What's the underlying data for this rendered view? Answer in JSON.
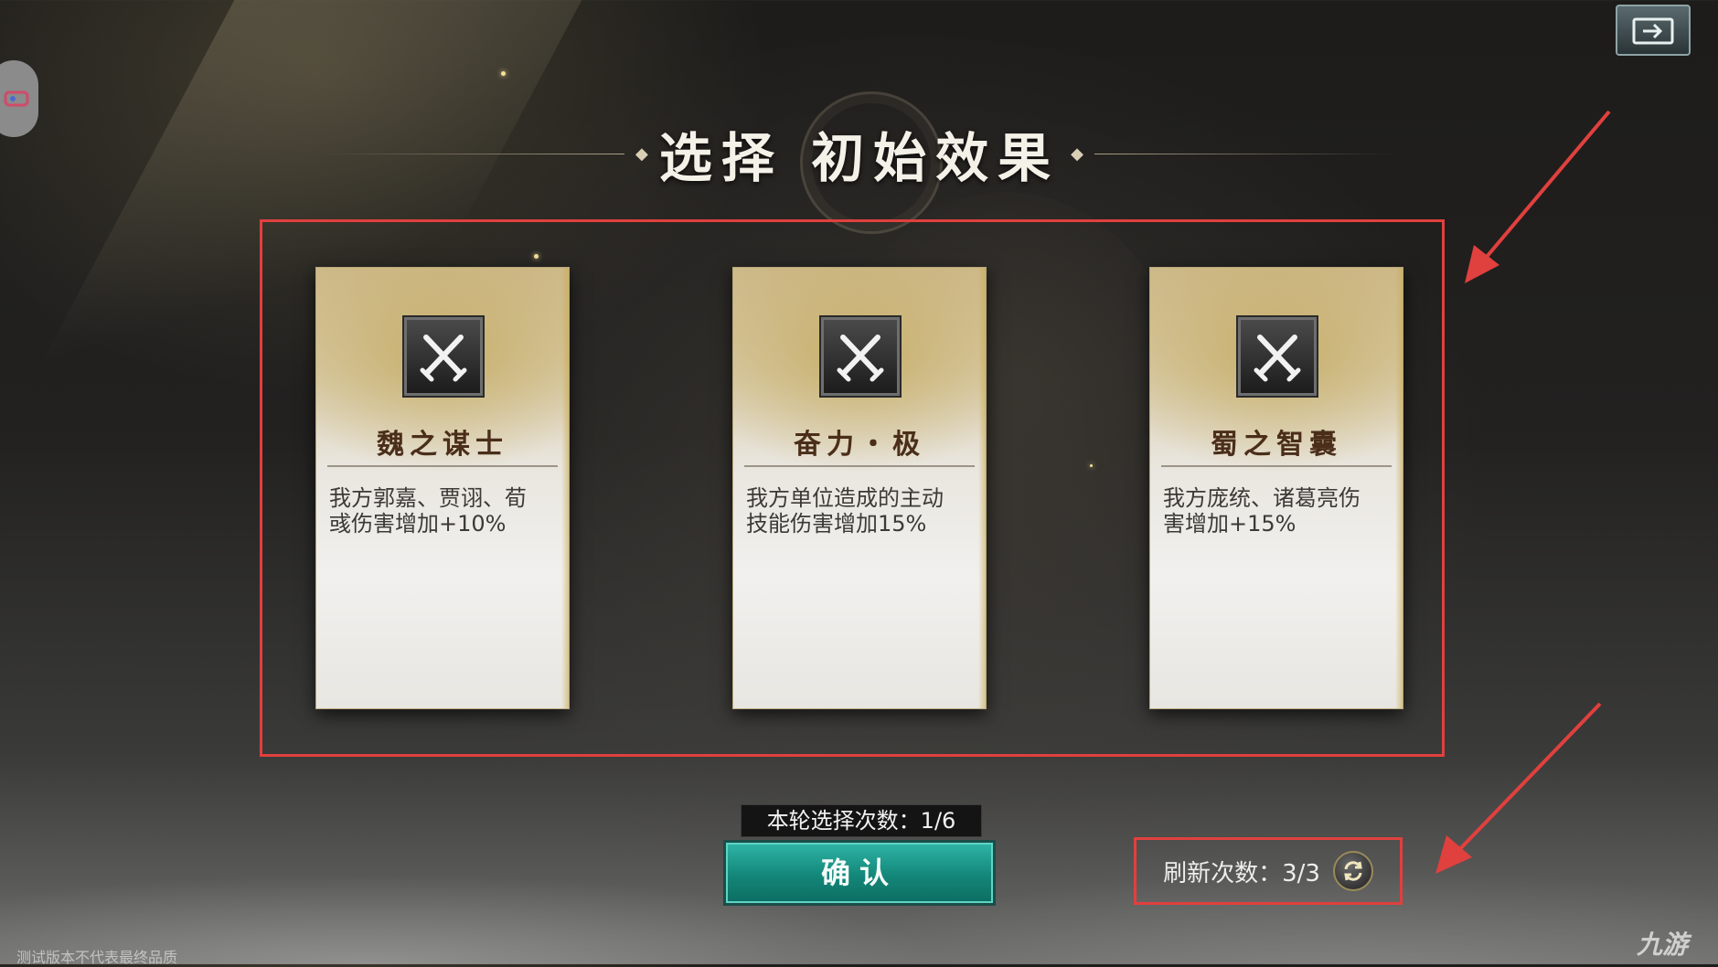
{
  "header": {
    "title": "选择 初始效果"
  },
  "cards": [
    {
      "icon": "crossed-swords-icon",
      "name": "魏之谋士",
      "description_line1": "我方郭嘉、贾诩、荀",
      "description_line2": "彧伤害增加+10%"
    },
    {
      "icon": "crossed-swords-icon",
      "name": "奋力・极",
      "description_line1": "我方单位造成的主动",
      "description_line2": "技能伤害增加15%"
    },
    {
      "icon": "crossed-swords-icon",
      "name": "蜀之智囊",
      "description_line1": "我方庞统、诸葛亮伤",
      "description_line2": "害增加+15%"
    }
  ],
  "footer": {
    "selection_count": "本轮选择次数：1/6",
    "confirm_label": "确认",
    "refresh_count": "刷新次数：3/3",
    "test_notice": "测试版本不代表最终品质",
    "watermark": "九游"
  },
  "colors": {
    "highlight_box": "#e0403e",
    "confirm_button": "#138779",
    "card_title": "#4a2e1a"
  }
}
